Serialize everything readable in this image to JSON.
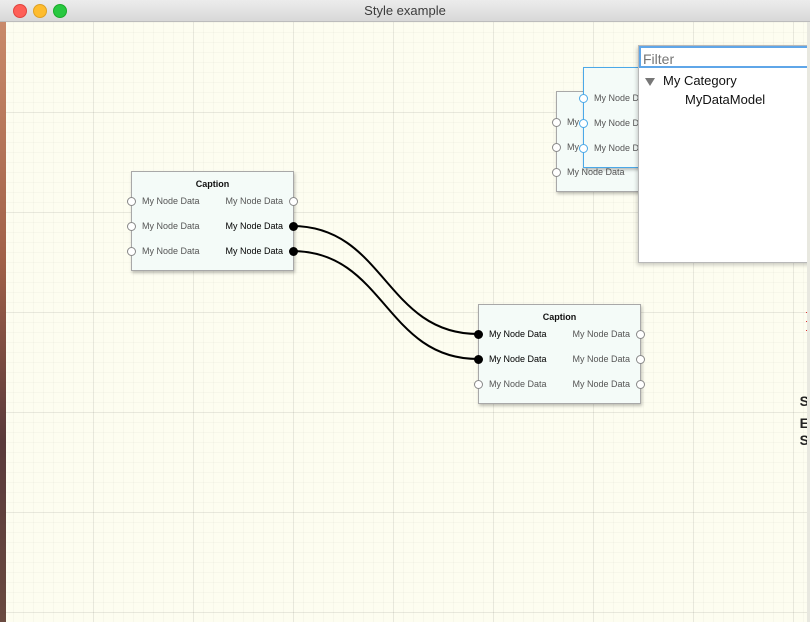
{
  "window": {
    "title": "Style example"
  },
  "nodes": [
    {
      "caption": "Caption",
      "rows": [
        {
          "in_label": "My Node Data",
          "out_label": "My Node Data",
          "in_active": false,
          "out_active": false
        },
        {
          "in_label": "My Node Data",
          "out_label": "My Node Data",
          "in_active": false,
          "out_active": true
        },
        {
          "in_label": "My Node Data",
          "out_label": "My Node Data",
          "in_active": false,
          "out_active": true
        }
      ]
    },
    {
      "caption": "Caption",
      "rows": [
        {
          "in_label": "My Node Data",
          "out_label": "My Node Data",
          "in_active": true,
          "out_active": false
        },
        {
          "in_label": "My Node Data",
          "out_label": "My Node Data",
          "in_active": true,
          "out_active": false
        },
        {
          "in_label": "My Node Data",
          "out_label": "My Node Data",
          "in_active": false,
          "out_active": false
        }
      ]
    },
    {
      "caption": "",
      "rows": [
        {
          "in_label": "My",
          "out_label": ""
        },
        {
          "in_label": "My",
          "out_label": ""
        },
        {
          "in_label": "My Node Data",
          "out_label": ""
        }
      ]
    },
    {
      "caption": "",
      "rows": [
        {
          "in_label": "My Node D",
          "out_label": ""
        },
        {
          "in_label": "My Node D",
          "out_label": ""
        },
        {
          "in_label": "My Node D",
          "out_label": ""
        }
      ]
    }
  ],
  "connections": [
    {
      "from": "node1.out.1",
      "to": "node2.in.1"
    },
    {
      "from": "node1.out.2",
      "to": "node2.in.0"
    }
  ],
  "popup": {
    "filter_placeholder": "Filter",
    "category": "My Category",
    "item": "MyDataModel"
  },
  "side_glyphs": [
    "S",
    "E",
    "S"
  ],
  "colors": {
    "canvas_bg": "#fdfdf0",
    "node_bg": "#f4fbf8",
    "selected_border": "#4aa8e8",
    "connection": "#000000"
  }
}
